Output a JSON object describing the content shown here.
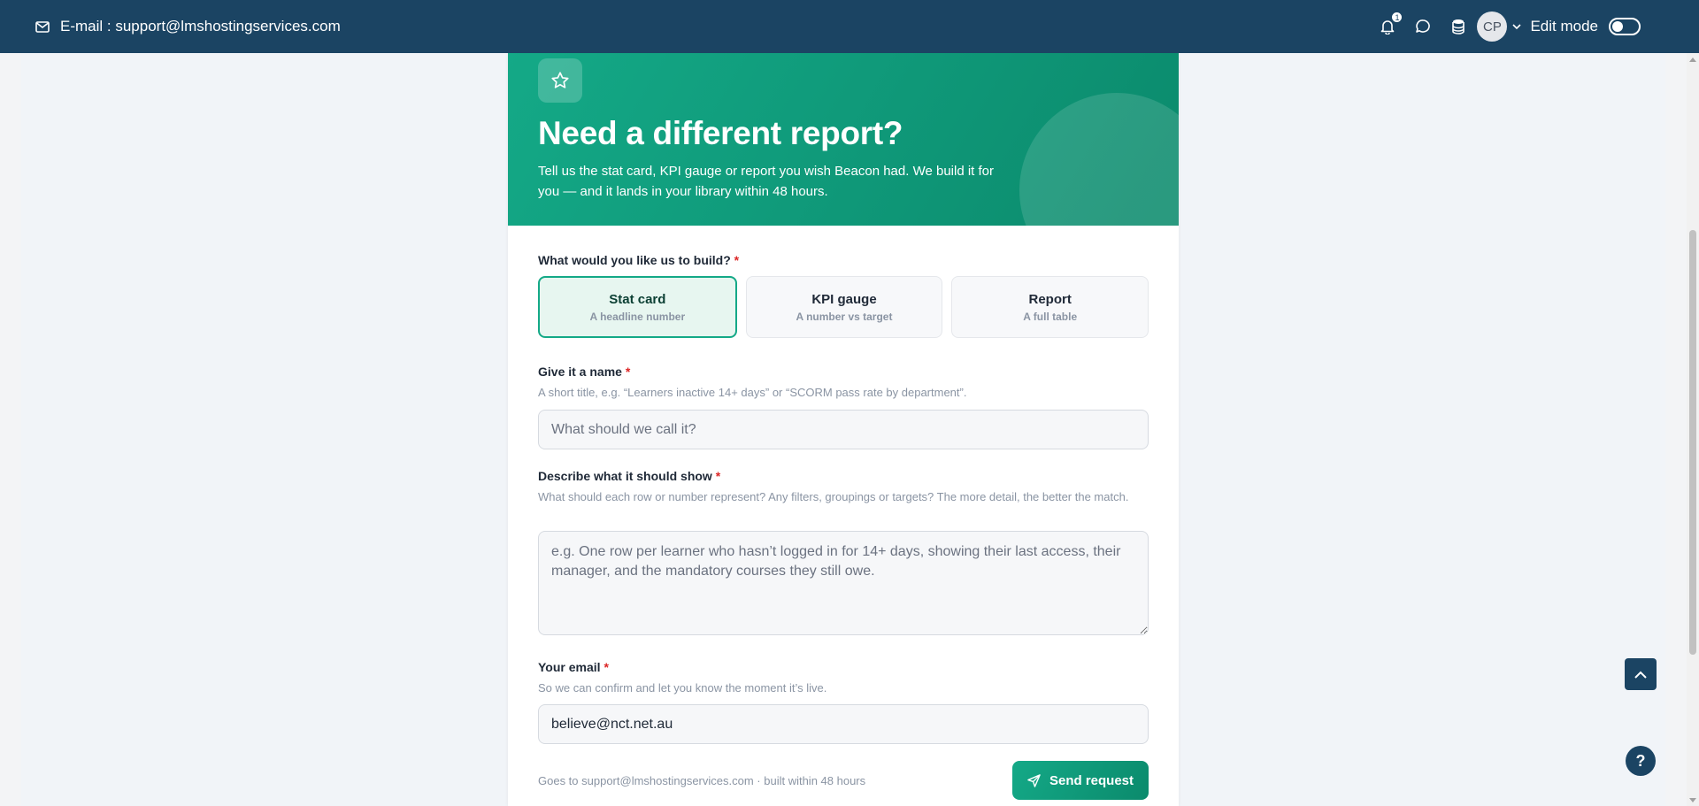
{
  "navbar": {
    "email_label": "E-mail : support@lmshostingservices.com",
    "notification_count": "1",
    "avatar_initials": "CP",
    "edit_mode_label": "Edit mode"
  },
  "hero": {
    "title": "Need a different report?",
    "subtitle": "Tell us the stat card, KPI gauge or report you wish Beacon had. We build it for you — and it lands in your library within 48 hours."
  },
  "form": {
    "build": {
      "label": "What would you like us to build?",
      "required_mark": "*",
      "options": [
        {
          "title": "Stat card",
          "desc": "A headline number",
          "selected": true
        },
        {
          "title": "KPI gauge",
          "desc": "A number vs target",
          "selected": false
        },
        {
          "title": "Report",
          "desc": "A full table",
          "selected": false
        }
      ]
    },
    "name": {
      "label": "Give it a name",
      "required_mark": "*",
      "hint": "A short title, e.g. “Learners inactive 14+ days” or “SCORM pass rate by department”.",
      "placeholder": "What should we call it?"
    },
    "describe": {
      "label": "Describe what it should show",
      "required_mark": "*",
      "hint": "What should each row or number represent? Any filters, groupings or targets? The more detail, the better the match.",
      "placeholder": "e.g. One row per learner who hasn’t logged in for 14+ days, showing their last access, their manager, and the mandatory courses they still owe."
    },
    "email": {
      "label": "Your email",
      "required_mark": "*",
      "hint": "So we can confirm and let you know the moment it’s live.",
      "value": "believe@nct.net.au"
    },
    "footer_note": "Goes to support@lmshostingservices.com · built within 48 hours",
    "send_label": "Send request"
  },
  "floating": {
    "help_label": "?"
  },
  "colors": {
    "navbar": "#1b4463",
    "accent": "#14a987",
    "accent_dark": "#0b8a6c",
    "required": "#dc2626"
  },
  "icons": [
    "mail-icon",
    "bell-icon",
    "chat-icon",
    "database-icon",
    "chevron-down-icon",
    "star-icon",
    "send-icon",
    "chevron-up-icon",
    "help-icon"
  ]
}
